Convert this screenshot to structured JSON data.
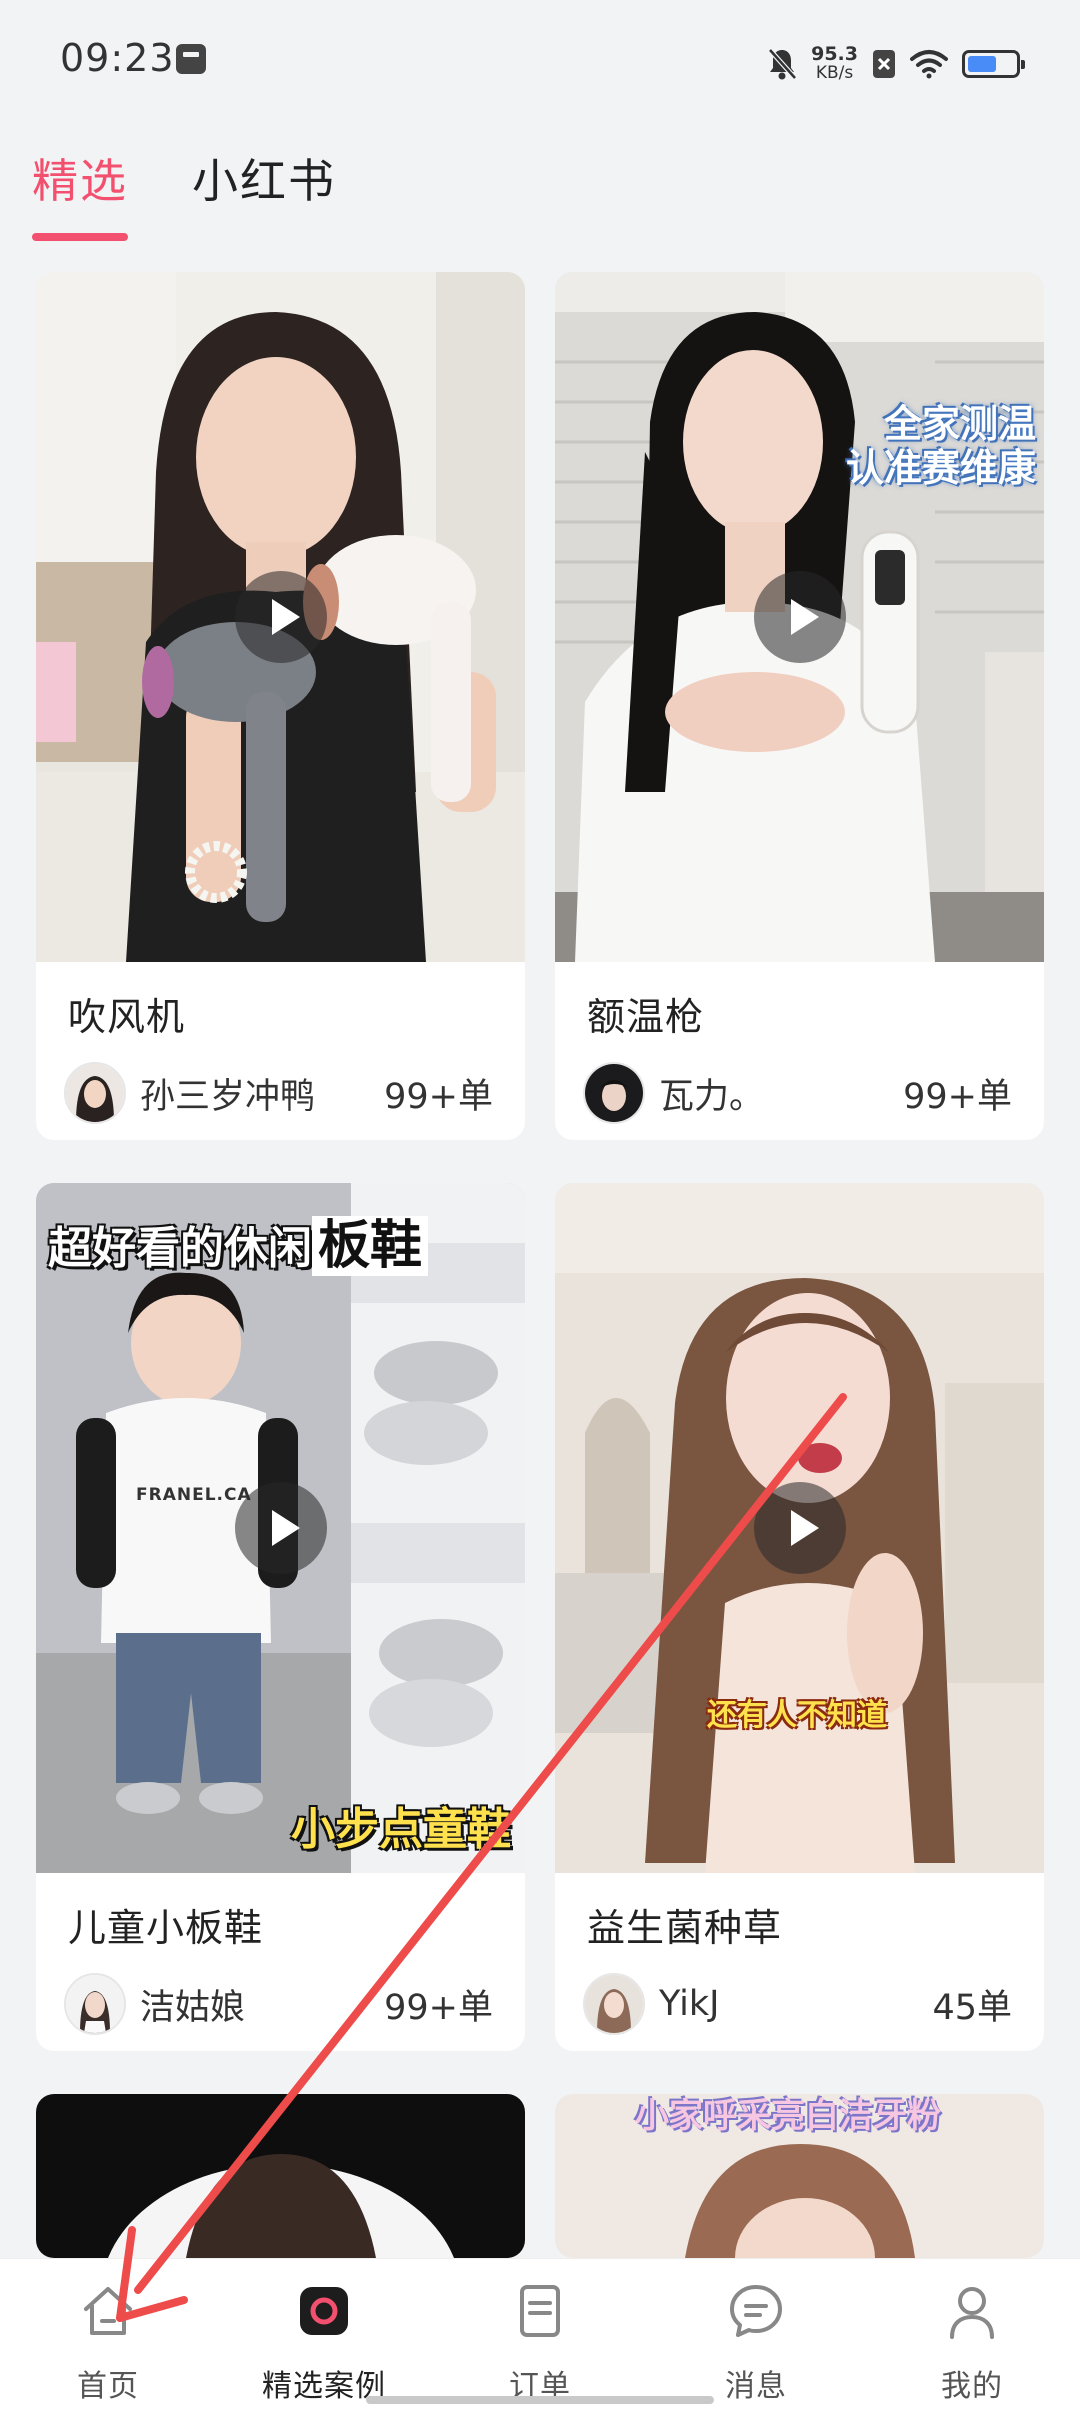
{
  "status_bar": {
    "time": "09:23",
    "net_speed_value": "95.3",
    "net_speed_unit": "KB/s"
  },
  "tabs": [
    {
      "label": "精选",
      "active": true
    },
    {
      "label": "小红书",
      "active": false
    }
  ],
  "cards": [
    {
      "title": "吹风机",
      "author": "孙三岁冲鸭",
      "orders": "99+单"
    },
    {
      "title": "额温枪",
      "author": "瓦力。",
      "orders": "99+单",
      "overlay_lines": [
        "全家测温",
        "认准赛维康"
      ]
    },
    {
      "title": "儿童小板鞋",
      "author": "洁姑娘",
      "orders": "99+单",
      "overlay_top": "超好看的休闲",
      "overlay_top_big": "板鞋",
      "overlay_bottom": "小步点童鞋",
      "shirt_text": "FRANEL.CA"
    },
    {
      "title": "益生菌种草",
      "author": "YikJ",
      "orders": "45单",
      "overlay_caption": "还有人不知道"
    }
  ],
  "partial_card_caption": "小家呼采亮白洁牙粉",
  "bottom_nav": [
    {
      "label": "首页",
      "icon": "home-icon"
    },
    {
      "label": "精选案例",
      "icon": "featured-cases-icon",
      "active": true
    },
    {
      "label": "订单",
      "icon": "order-icon"
    },
    {
      "label": "消息",
      "icon": "message-icon"
    },
    {
      "label": "我的",
      "icon": "profile-icon"
    }
  ],
  "colors": {
    "accent": "#f2506e",
    "background": "#f2f3f5",
    "annotation_arrow": "#ee4b4b"
  }
}
